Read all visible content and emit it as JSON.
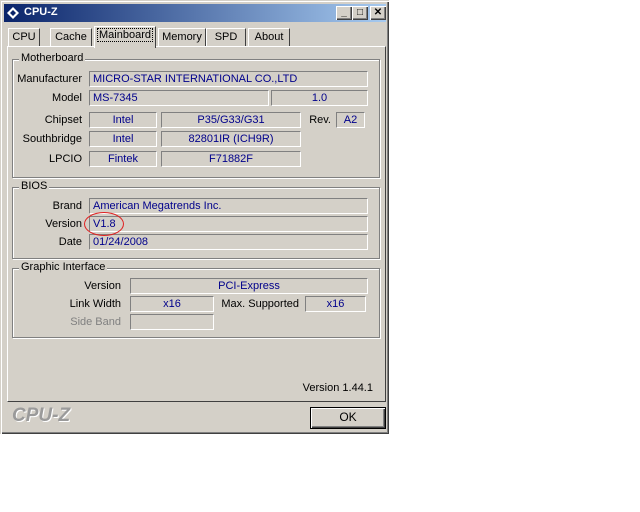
{
  "window": {
    "title": "CPU-Z"
  },
  "tabs": [
    "CPU",
    "Cache",
    "Mainboard",
    "Memory",
    "SPD",
    "About"
  ],
  "motherboard": {
    "group_title": "Motherboard",
    "manufacturer_label": "Manufacturer",
    "manufacturer": "MICRO-STAR INTERNATIONAL CO.,LTD",
    "model_label": "Model",
    "model": "MS-7345",
    "model_rev": "1.0",
    "chipset_label": "Chipset",
    "chipset_vendor": "Intel",
    "chipset_name": "P35/G33/G31",
    "rev_label": "Rev.",
    "rev": "A2",
    "southbridge_label": "Southbridge",
    "southbridge_vendor": "Intel",
    "southbridge_name": "82801IR (ICH9R)",
    "lpcio_label": "LPCIO",
    "lpcio_vendor": "Fintek",
    "lpcio_name": "F71882F"
  },
  "bios": {
    "group_title": "BIOS",
    "brand_label": "Brand",
    "brand": "American Megatrends Inc.",
    "version_label": "Version",
    "version": "V1.8",
    "date_label": "Date",
    "date": "01/24/2008"
  },
  "graphic": {
    "group_title": "Graphic Interface",
    "version_label": "Version",
    "version": "PCI-Express",
    "link_width_label": "Link Width",
    "link_width": "x16",
    "max_supported_label": "Max. Supported",
    "max_supported": "x16",
    "side_band_label": "Side Band",
    "side_band": ""
  },
  "footer": {
    "version": "Version 1.44.1",
    "logo": "CPU-Z",
    "ok_label": "OK"
  },
  "colors": {
    "annotation": "#e02020",
    "value_text": "#00008b"
  }
}
